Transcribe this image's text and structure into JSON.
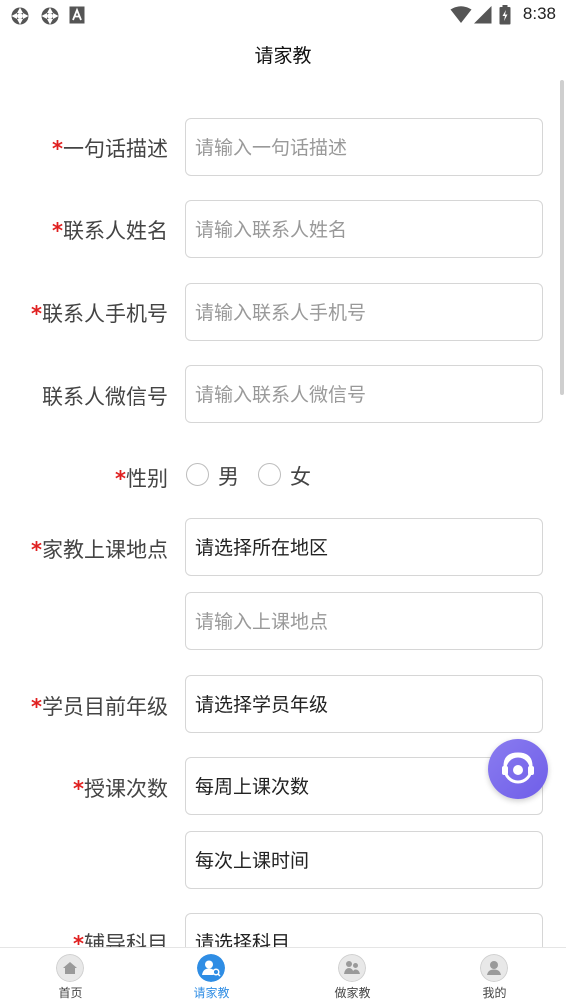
{
  "status_bar": {
    "time": "8:38"
  },
  "header": {
    "title": "请家教"
  },
  "form": {
    "description": {
      "label": "一句话描述",
      "placeholder": "请输入一句话描述",
      "required": true
    },
    "contact_name": {
      "label": "联系人姓名",
      "placeholder": "请输入联系人姓名",
      "required": true
    },
    "contact_phone": {
      "label": "联系人手机号",
      "placeholder": "请输入联系人手机号",
      "required": true
    },
    "contact_wechat": {
      "label": "联系人微信号",
      "placeholder": "请输入联系人微信号",
      "required": false
    },
    "gender": {
      "label": "性别",
      "options": [
        "男",
        "女"
      ],
      "required": true
    },
    "location": {
      "label": "家教上课地点",
      "region_value": "请选择所在地区",
      "address_placeholder": "请输入上课地点",
      "required": true
    },
    "grade": {
      "label": "学员目前年级",
      "value": "请选择学员年级",
      "required": true
    },
    "lessons": {
      "label": "授课次数",
      "times_value": "每周上课次数",
      "time_value": "每次上课时间",
      "required": true
    },
    "subject": {
      "label": "辅导科目",
      "value": "请选择科目",
      "required": true
    }
  },
  "required_marker": "*",
  "tabbar": {
    "items": [
      {
        "label": "首页",
        "icon": "home-icon",
        "active": false
      },
      {
        "label": "请家教",
        "icon": "user-search-icon",
        "active": true
      },
      {
        "label": "做家教",
        "icon": "tutor-icon",
        "active": false
      },
      {
        "label": "我的",
        "icon": "profile-icon",
        "active": false
      }
    ]
  },
  "colors": {
    "accent": "#2f8de4",
    "required": "#e02020",
    "float_button": "#7b6cee"
  }
}
